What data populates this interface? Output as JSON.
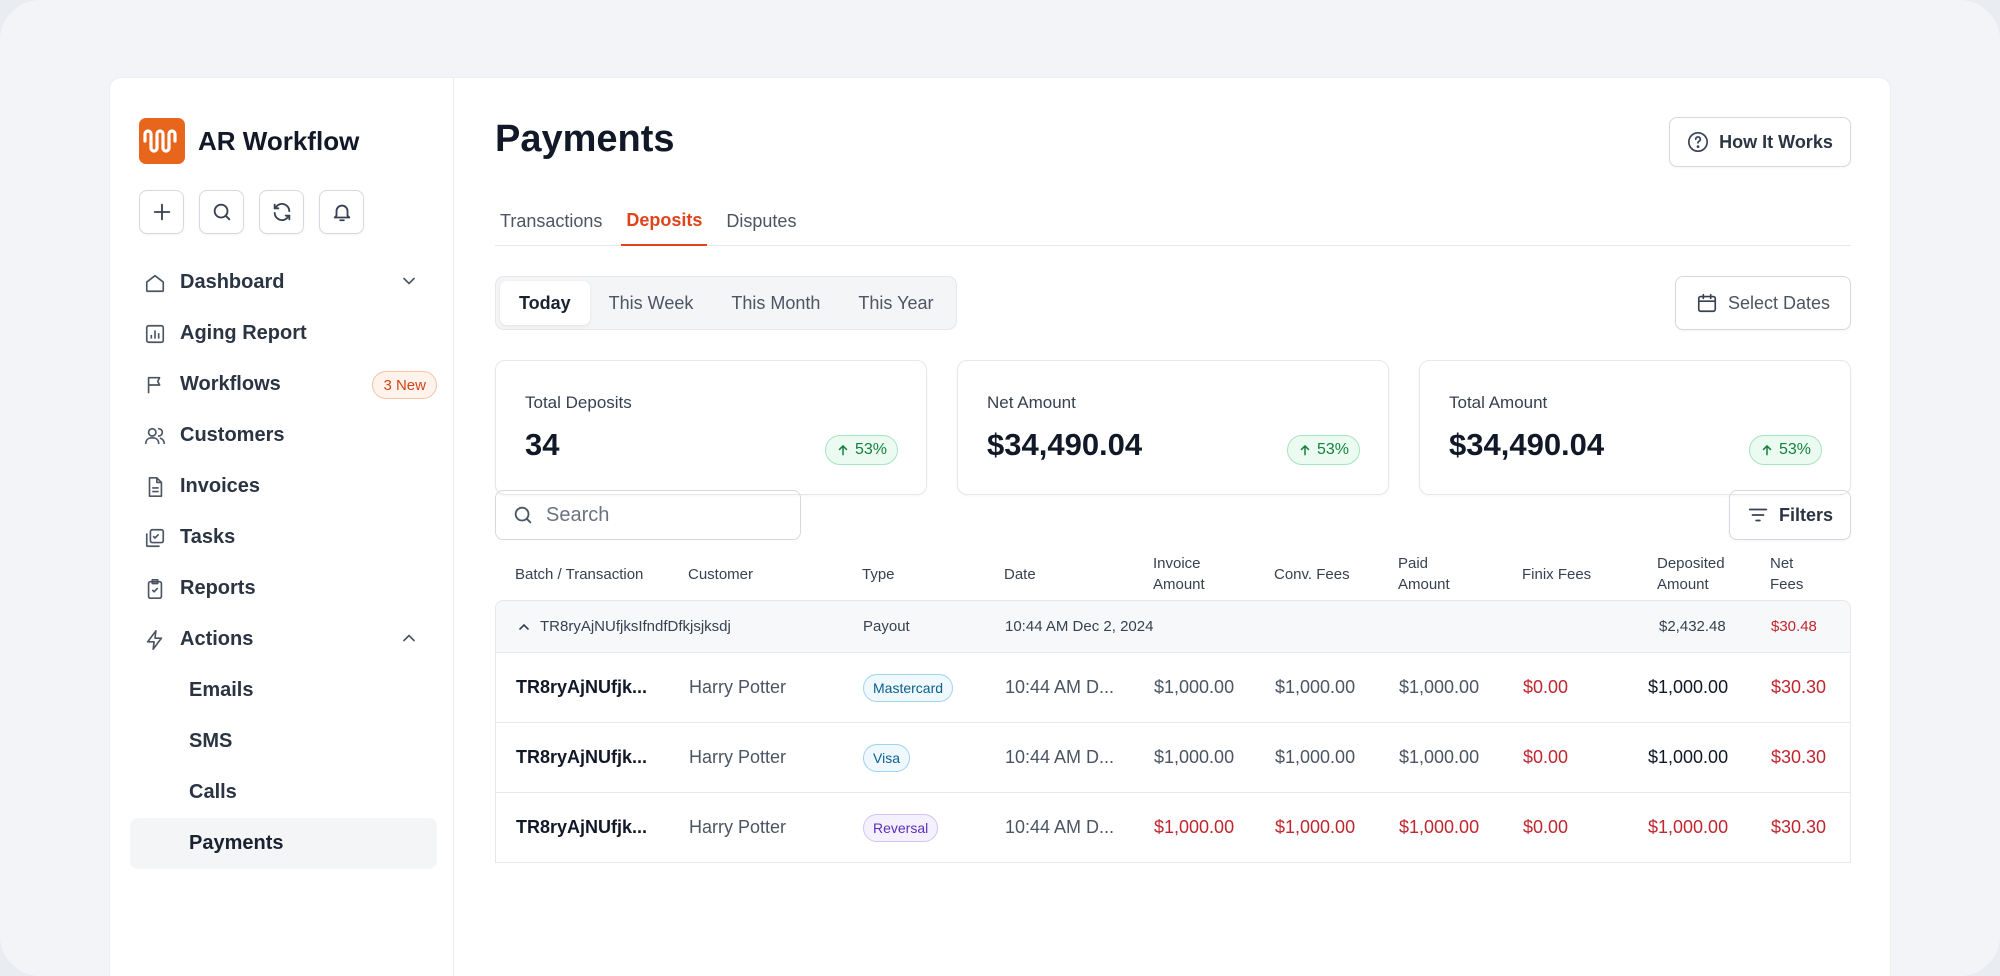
{
  "app": {
    "name": "AR Workflow"
  },
  "sidebar": {
    "quick_actions": [
      {
        "name": "add",
        "icon": "plus-icon"
      },
      {
        "name": "search",
        "icon": "search-icon"
      },
      {
        "name": "refresh",
        "icon": "refresh-icon"
      },
      {
        "name": "notifications",
        "icon": "bell-icon"
      }
    ],
    "nav": {
      "dashboard": "Dashboard",
      "aging_report": "Aging Report",
      "workflows": "Workflows",
      "workflows_badge": "3 New",
      "customers": "Customers",
      "invoices": "Invoices",
      "tasks": "Tasks",
      "reports": "Reports",
      "actions": "Actions",
      "emails": "Emails",
      "sms": "SMS",
      "calls": "Calls",
      "payments": "Payments"
    }
  },
  "page": {
    "title": "Payments",
    "how_it_works": "How It Works",
    "tabs": [
      "Transactions",
      "Deposits",
      "Disputes"
    ],
    "active_tab": "Deposits",
    "periods": [
      "Today",
      "This Week",
      "This Month",
      "This Year"
    ],
    "active_period": "Today",
    "select_dates": "Select Dates",
    "search_placeholder": "Search",
    "filters": "Filters"
  },
  "stats": [
    {
      "label": "Total Deposits",
      "value": "34",
      "change": "53%"
    },
    {
      "label": "Net Amount",
      "value": "$34,490.04",
      "change": "53%"
    },
    {
      "label": "Total Amount",
      "value": "$34,490.04",
      "change": "53%"
    }
  ],
  "table": {
    "headers": {
      "batch": "Batch / Transaction",
      "customer": "Customer",
      "type": "Type",
      "date": "Date",
      "invoice_amount": "Invoice Amount",
      "conv_fees": "Conv. Fees",
      "paid_amount": "Paid Amount",
      "finix_fees": "Finix Fees",
      "deposited_amount": "Deposited Amount",
      "net_fees": "Net Fees"
    },
    "group": {
      "batch_id": "TR8ryAjNUfjksIfndfDfkjsjksdj",
      "type": "Payout",
      "date": "10:44 AM Dec 2, 2024",
      "deposited_amount": "$2,432.48",
      "net_fees": "$30.48"
    },
    "rows": [
      {
        "transaction": "TR8ryAjNUfjk...",
        "customer": "Harry Potter",
        "type": "Mastercard",
        "date": "10:44 AM D...",
        "invoice_amount": "$1,000.00",
        "conv_fees": "$1,000.00",
        "paid_amount": "$1,000.00",
        "finix_fees": "$0.00",
        "deposited_amount": "$1,000.00",
        "net_fees": "$30.30"
      },
      {
        "transaction": "TR8ryAjNUfjk...",
        "customer": "Harry Potter",
        "type": "Visa",
        "date": "10:44 AM D...",
        "invoice_amount": "$1,000.00",
        "conv_fees": "$1,000.00",
        "paid_amount": "$1,000.00",
        "finix_fees": "$0.00",
        "deposited_amount": "$1,000.00",
        "net_fees": "$30.30"
      },
      {
        "transaction": "TR8ryAjNUfjk...",
        "customer": "Harry Potter",
        "type": "Reversal",
        "date": "10:44 AM D...",
        "invoice_amount": "$1,000.00",
        "conv_fees": "$1,000.00",
        "paid_amount": "$1,000.00",
        "finix_fees": "$0.00",
        "deposited_amount": "$1,000.00",
        "net_fees": "$30.30"
      }
    ]
  },
  "colors": {
    "brand": "#e8661c",
    "accent": "#e0441b",
    "negative": "#c0262d",
    "positive": "#15803d"
  }
}
